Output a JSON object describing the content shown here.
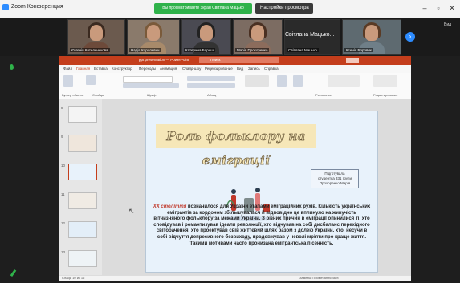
{
  "zoom": {
    "window_title": "Zoom Конференция",
    "share_banner": "Вы просматриваете экран Світлана Мацько",
    "view_options": "Настройки просмотра",
    "big_name": "Світлана Мацько...",
    "side_label": "Вид"
  },
  "participants": [
    {
      "name": "Євгенія Котельникова"
    },
    {
      "name": "Надія Королевич"
    },
    {
      "name": "Катерина Бариш"
    },
    {
      "name": "Марія Прохоренко"
    },
    {
      "name": "Світлана Мацько"
    },
    {
      "name": "Ксенія Боровик"
    }
  ],
  "ppt": {
    "doc_title": "ppt presentation — PowerPoint",
    "search_placeholder": "Поиск",
    "menu": [
      "Файл",
      "Главная",
      "Вставка",
      "Конструктор",
      "Переходы",
      "Анимация",
      "Слайд-шоу",
      "Рецензирование",
      "Вид",
      "Запись",
      "Справка"
    ],
    "ribbon_groups": [
      "Буфер обмена",
      "Слайды",
      "Шрифт",
      "Абзац",
      "Рисование",
      "Редактирование"
    ],
    "thumb_numbers": [
      "8",
      "9",
      "10",
      "11",
      "12",
      "13"
    ],
    "status_left": "Слайд 10 из 16",
    "status_right": "Заметки   Примечания   46%"
  },
  "slide": {
    "title": "Роль фольклору на еміграції",
    "author_lines": [
      "Підготувала",
      "студентка 331 групи",
      "Прохоренко Марія"
    ],
    "body_highlight": "XX століття",
    "body_rest": " позначилося для України етапами еміграційних рухів. Кількість українських емігрантів за кордоном збільшувалася й відповідно це вплинуло на живучість вітчизняного фольклору за межами України. З різних причин в еміграції опинилися ті, хто сповідував і романтизував ідеали революції, хто відчував на собі дисбаланс перехідного світобачення, хто проектував свій життєвий шлях разом з долею України, хто, несучи в собі відчуття депресивного безвиходу, продовжував у неволі мріяти про краще життя. Такими мотивами часто пронизана емігрантська пісенність."
  },
  "colors": {
    "ppt_accent": "#c43e1c",
    "zoom_green": "#2fb24a",
    "zoom_blue": "#2d8cff"
  }
}
